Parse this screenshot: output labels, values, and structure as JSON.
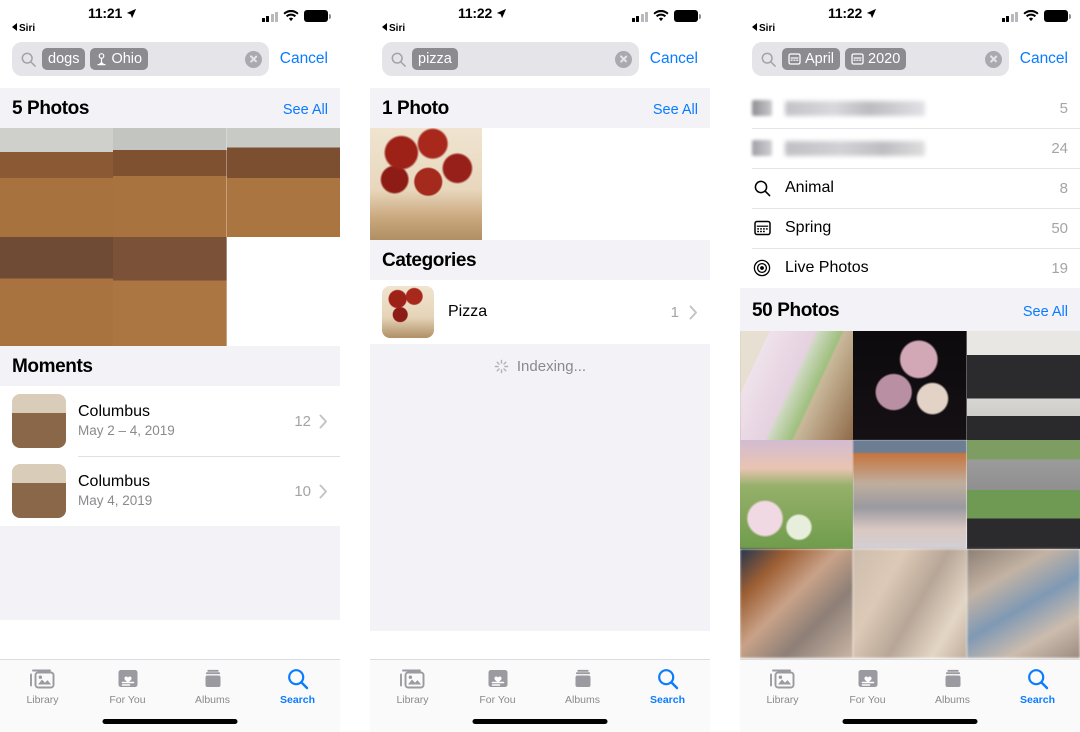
{
  "theme": {
    "accent": "#0a7cff",
    "token_bg": "#8b8b90",
    "field_bg": "#e4e4e9",
    "section_bg": "#f2f2f7",
    "secondary_text": "#8a8a8e",
    "count_text": "#a4a4a9"
  },
  "panels": [
    {
      "id": "panel-dogs-ohio",
      "status": {
        "time": "11:21",
        "back_label": "Siri",
        "location_icon": "location-arrow-icon",
        "signal_icon": "cellular-bars-icon",
        "wifi_icon": "wifi-icon",
        "battery_icon": "battery-icon"
      },
      "search": {
        "search_icon": "search-icon",
        "tokens": [
          {
            "label": "dogs",
            "icon": null
          },
          {
            "label": "Ohio",
            "icon": "location-pin-icon"
          }
        ],
        "clear_icon": "clear-circle-icon",
        "cancel_label": "Cancel"
      },
      "photos_section": {
        "title": "5 Photos",
        "see_all": "See All",
        "count": 5
      },
      "photos": [
        {
          "alt": "girl petting yellow dog on wood floor"
        },
        {
          "alt": "girl sitting on hearth with dog"
        },
        {
          "alt": "girl hugging dog"
        },
        {
          "alt": "yellow labrador sitting, tongue out"
        },
        {
          "alt": "yellow labrador close up sitting"
        }
      ],
      "moments_section": {
        "title": "Moments"
      },
      "moments": [
        {
          "title": "Columbus",
          "subtitle": "May 2 – 4, 2019",
          "count": "12",
          "chevron": "chevron-right-icon"
        },
        {
          "title": "Columbus",
          "subtitle": "May 4, 2019",
          "count": "10",
          "chevron": "chevron-right-icon"
        }
      ],
      "tabs": [
        {
          "label": "Library",
          "icon": "photos-library-icon",
          "active": false
        },
        {
          "label": "For You",
          "icon": "for-you-card-icon",
          "active": false
        },
        {
          "label": "Albums",
          "icon": "albums-stack-icon",
          "active": false
        },
        {
          "label": "Search",
          "icon": "search-icon",
          "active": true
        }
      ]
    },
    {
      "id": "panel-pizza",
      "status": {
        "time": "11:22",
        "back_label": "Siri",
        "location_icon": "location-arrow-icon",
        "signal_icon": "cellular-bars-icon",
        "wifi_icon": "wifi-icon",
        "battery_icon": "battery-icon"
      },
      "search": {
        "search_icon": "search-icon",
        "tokens": [
          {
            "label": "pizza",
            "icon": null
          }
        ],
        "clear_icon": "clear-circle-icon",
        "cancel_label": "Cancel"
      },
      "photos_section": {
        "title": "1 Photo",
        "see_all": "See All",
        "count": 1
      },
      "photos": [
        {
          "alt": "pepperoni pizza close up"
        }
      ],
      "categories_section": {
        "title": "Categories"
      },
      "categories": [
        {
          "label": "Pizza",
          "count": "1",
          "chevron": "chevron-right-icon"
        }
      ],
      "indexing": {
        "label": "Indexing...",
        "icon": "activity-spinner-icon"
      },
      "tabs": [
        {
          "label": "Library",
          "icon": "photos-library-icon",
          "active": false
        },
        {
          "label": "For You",
          "icon": "for-you-card-icon",
          "active": false
        },
        {
          "label": "Albums",
          "icon": "albums-stack-icon",
          "active": false
        },
        {
          "label": "Search",
          "icon": "search-icon",
          "active": true
        }
      ]
    },
    {
      "id": "panel-april-2020",
      "status": {
        "time": "11:22",
        "back_label": "Siri",
        "location_icon": "location-arrow-icon",
        "signal_icon": "cellular-bars-icon",
        "wifi_icon": "wifi-icon",
        "battery_icon": "battery-icon"
      },
      "search": {
        "search_icon": "search-icon",
        "tokens": [
          {
            "label": "April",
            "icon": "calendar-icon"
          },
          {
            "label": "2020",
            "icon": "calendar-icon"
          }
        ],
        "clear_icon": "clear-circle-icon",
        "cancel_label": "Cancel"
      },
      "suggestions": [
        {
          "label": "",
          "redacted": true,
          "count": "5",
          "icon": null
        },
        {
          "label": "",
          "redacted": true,
          "count": "24",
          "icon": null
        },
        {
          "label": "Animal",
          "redacted": false,
          "count": "8",
          "icon": "search-icon"
        },
        {
          "label": "Spring",
          "redacted": false,
          "count": "50",
          "icon": "calendar-icon"
        },
        {
          "label": "Live Photos",
          "redacted": false,
          "count": "19",
          "icon": "live-photos-icon"
        }
      ],
      "photos_section": {
        "title": "50 Photos",
        "see_all": "See All",
        "count": 50
      },
      "photos": [
        {
          "alt": "iphone on table by window"
        },
        {
          "alt": "dark moody peonies"
        },
        {
          "alt": "black desk with chair"
        },
        {
          "alt": "easter eggs on grass at sunset"
        },
        {
          "alt": "blurred photo of people"
        },
        {
          "alt": "black mailbox by street"
        },
        {
          "alt": "blurred photo"
        },
        {
          "alt": "blurred photo"
        },
        {
          "alt": "blurred photo"
        }
      ],
      "tabs": [
        {
          "label": "Library",
          "icon": "photos-library-icon",
          "active": false
        },
        {
          "label": "For You",
          "icon": "for-you-card-icon",
          "active": false
        },
        {
          "label": "Albums",
          "icon": "albums-stack-icon",
          "active": false
        },
        {
          "label": "Search",
          "icon": "search-icon",
          "active": true
        }
      ]
    }
  ]
}
